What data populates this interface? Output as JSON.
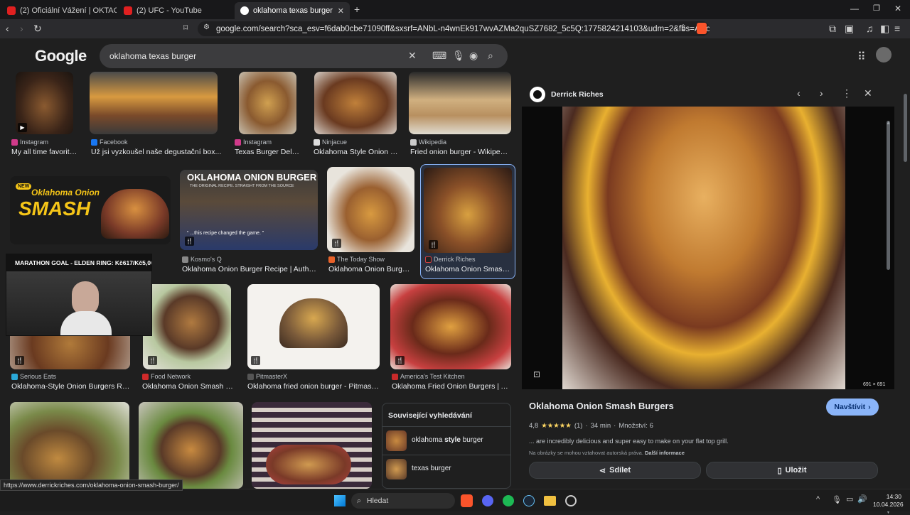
{
  "browser": {
    "tabs": [
      {
        "title": "(2) Oficiální Vážení | OKTAGON 86 c..."
      },
      {
        "title": "(2) UFC - YouTube"
      },
      {
        "title": "oklahoma texas burger - Hledat"
      }
    ],
    "new_tab": "+",
    "url": "google.com/search?sca_esv=f6dab0cbe71090ff&sxsrf=ANbL-n4wnEk917wvAZMa2quSZ7682_5c5Q:1775824214103&udm=2&fbs=ADc_l-ZseckkBJUFopaG...",
    "accent": "#8ab4f8"
  },
  "google": {
    "logo": "Google",
    "query": "oklahoma texas burger"
  },
  "results": [
    {
      "source": "Instagram",
      "caption": "My all time favorite...",
      "color": "#6a4a30"
    },
    {
      "source": "Facebook",
      "caption": "Už jsi vyzkoušel naše degustační box...",
      "color": "#c89040"
    },
    {
      "source": "Instagram",
      "caption": "Texas Burger Deliv...",
      "color": "#b88a4a"
    },
    {
      "source": "Ninjacue",
      "caption": "Oklahoma Style Onion S...",
      "color": "#8a5a30"
    },
    {
      "source": "Wikipedia",
      "caption": "Fried onion burger - Wikipedia",
      "color": "#a88a5a"
    },
    {
      "source": "Kosmo's Q",
      "caption": "Oklahoma Onion Burger Recipe | Authent...",
      "color": "#2a3a5a"
    },
    {
      "source": "The Today Show",
      "caption": "Oklahoma Onion Burger ...",
      "color": "#a07030"
    },
    {
      "source": "Derrick Riches",
      "caption": "Oklahoma Onion Smash ...",
      "color": "#8a5028"
    },
    {
      "source": "Serious Eats",
      "caption": "Oklahoma-Style Onion Burgers Reci...",
      "color": "#9a6a3a"
    },
    {
      "source": "Food Network",
      "caption": "Oklahoma Onion Smash Bu...",
      "color": "#7a5a3a"
    },
    {
      "source": "PitmasterX",
      "caption": "Oklahoma fried onion burger - PitmasterX",
      "color": "#eeeae4"
    },
    {
      "source": "America's Test Kitchen",
      "caption": "Oklahoma Fried Onion Burgers | Am...",
      "color": "#9a4a2a"
    }
  ],
  "ad_tile": {
    "line1": "Oklahoma Onion",
    "line2": "SMASH",
    "new": "NEW"
  },
  "kosmo_tile": {
    "title": "OKLAHOMA ONION BURGER",
    "sub": "THE ORIGINAL RECIPE. STRAIGHT FROM THE SOURCE",
    "quote": "“ ...this recipe changed the game. ”"
  },
  "bottom_row": [
    {
      "color": "#7a8a4a"
    },
    {
      "color": "#6a5a3a"
    },
    {
      "color": "#8a6a5a"
    }
  ],
  "stream": {
    "goal": "MARATHON GOAL - ELDEN RING: Kč617/Kč5,000"
  },
  "related": {
    "title": "Související vyhledávání",
    "items": [
      {
        "pre": "oklahoma ",
        "bold": "style",
        "post": " burger"
      },
      {
        "pre": "texas burger",
        "bold": "",
        "post": ""
      }
    ]
  },
  "panel": {
    "publisher": "Derrick Riches",
    "title": "Oklahoma Onion Smash Burgers",
    "visit": "Navštívit",
    "rating": "4,8",
    "stars": "★★★★★",
    "reviews": "(1)",
    "time": "34 min",
    "servings": "Množství: 6",
    "snippet": "... are incredibly delicious and super easy to make on your flat top grill.",
    "copyright": "Na obrázky se mohou vztahovat autorská práva.",
    "more": "Další informace",
    "dims": "691 × 691",
    "share": "Sdílet",
    "save": "Uložit"
  },
  "status_url": "https://www.derrickriches.com/oklahoma-onion-smash-burger/",
  "taskbar": {
    "search": "Hledat",
    "time": "14:30",
    "date": "10.04.2026"
  }
}
